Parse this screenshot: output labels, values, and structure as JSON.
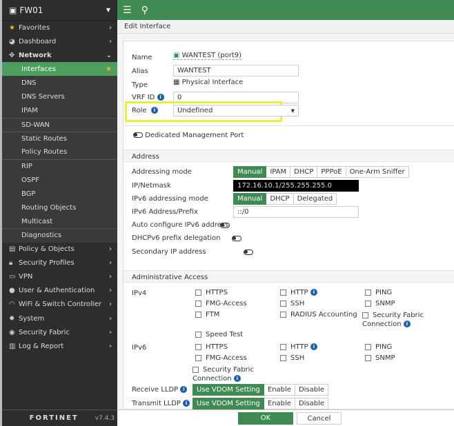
{
  "sidebar": {
    "device": "FW01",
    "items": [
      {
        "label": "Favorites",
        "icon": "star-icon"
      },
      {
        "label": "Dashboard",
        "icon": "dashboard-icon"
      },
      {
        "label": "Network",
        "icon": "network-icon"
      },
      {
        "label": "Interfaces"
      },
      {
        "label": "DNS"
      },
      {
        "label": "DNS Servers"
      },
      {
        "label": "IPAM"
      },
      {
        "label": "SD-WAN"
      },
      {
        "label": "Static Routes"
      },
      {
        "label": "Policy Routes"
      },
      {
        "label": "RIP"
      },
      {
        "label": "OSPF"
      },
      {
        "label": "BGP"
      },
      {
        "label": "Routing Objects"
      },
      {
        "label": "Multicast"
      },
      {
        "label": "Diagnostics"
      },
      {
        "label": "Policy & Objects",
        "icon": "policy-icon"
      },
      {
        "label": "Security Profiles",
        "icon": "lock-icon"
      },
      {
        "label": "VPN",
        "icon": "vpn-icon"
      },
      {
        "label": "User & Authentication",
        "icon": "user-icon"
      },
      {
        "label": "WiFi & Switch Controller",
        "icon": "wifi-icon"
      },
      {
        "label": "System",
        "icon": "gear-icon"
      },
      {
        "label": "Security Fabric",
        "icon": "fabric-icon"
      },
      {
        "label": "Log & Report",
        "icon": "chart-icon"
      }
    ],
    "logo": "FORTINET",
    "version": "v7.4.3"
  },
  "page_title": "Edit Interface",
  "form": {
    "name_label": "Name",
    "name_value": "WANTEST (port9)",
    "alias_label": "Alias",
    "alias_value": "WANTEST",
    "type_label": "Type",
    "type_value": "Physical Interface",
    "vrf_label": "VRF ID",
    "vrf_value": "0",
    "role_label": "Role",
    "role_value": "Undefined",
    "dedicated_mgmt": "Dedicated Management Port"
  },
  "address": {
    "section": "Address",
    "addressing_mode_label": "Addressing mode",
    "addressing_modes": [
      "Manual",
      "IPAM",
      "DHCP",
      "PPPoE",
      "One-Arm Sniffer"
    ],
    "ip_label": "IP/Netmask",
    "ip_value": "172.16.10.1/255.255.255.0",
    "ipv6_mode_label": "IPv6 addressing mode",
    "ipv6_modes": [
      "Manual",
      "DHCP",
      "Delegated"
    ],
    "ipv6_prefix_label": "IPv6 Address/Prefix",
    "ipv6_prefix_value": "::/0",
    "auto_ipv6": "Auto configure IPv6 address",
    "dhcpv6_pd": "DHCPv6 prefix delegation",
    "secondary_ip": "Secondary IP address"
  },
  "admin": {
    "section": "Administrative Access",
    "ipv4_label": "IPv4",
    "ipv6_label": "IPv6",
    "ipv4": [
      "HTTPS",
      "HTTP",
      "PING",
      "FMG-Access",
      "SSH",
      "SNMP",
      "FTM",
      "RADIUS Accounting",
      "Security Fabric Connection",
      "Speed Test"
    ],
    "ipv6": [
      "HTTPS",
      "HTTP",
      "PING",
      "FMG-Access",
      "SSH",
      "SNMP",
      "Security Fabric Connection"
    ]
  },
  "lldp": {
    "receive_label": "Receive LLDP",
    "transmit_label": "Transmit LLDP",
    "options": [
      "Use VDOM Setting",
      "Enable",
      "Disable"
    ]
  },
  "footer": {
    "ok": "OK",
    "cancel": "Cancel"
  }
}
